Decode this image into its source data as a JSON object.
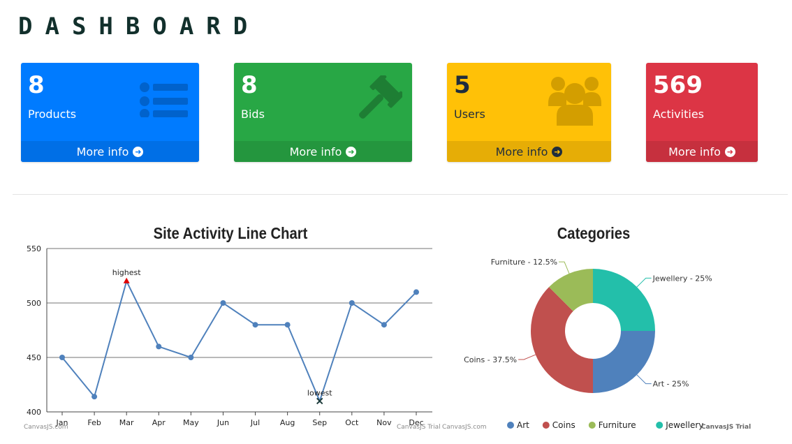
{
  "page": {
    "title": "DASHBOARD"
  },
  "cards": [
    {
      "value": "8",
      "label": "Products",
      "footer": "More info",
      "icon": "list-icon",
      "bg": "#007bff",
      "footer_bg": "#006fe6",
      "text_color": "#ffffff",
      "icon_color": "#0062cc"
    },
    {
      "value": "8",
      "label": "Bids",
      "footer": "More info",
      "icon": "gavel-icon",
      "bg": "#28a745",
      "footer_bg": "#24963e",
      "text_color": "#ffffff",
      "icon_color": "#1e7e34"
    },
    {
      "value": "5",
      "label": "Users",
      "footer": "More info",
      "icon": "users-icon",
      "bg": "#ffc107",
      "footer_bg": "#e6ad06",
      "text_color": "#1f2d3d",
      "icon_color": "#d39e00"
    },
    {
      "value": "569",
      "label": "Activities",
      "footer": "More info",
      "icon": "bar-chart-icon",
      "bg": "#dc3545",
      "footer_bg": "#c6303e",
      "text_color": "#ffffff",
      "icon_color": "#bd2130"
    }
  ],
  "line_chart": {
    "credit_left": "CanvasJS.com",
    "credit_right": "CanvasJS Trial"
  },
  "pie_chart": {
    "credit_left": "CanvasJS.com",
    "credit_right": "CanvasJS Trial"
  },
  "chart_data": [
    {
      "type": "line",
      "title": "Site Activity Line Chart",
      "categories": [
        "Jan",
        "Feb",
        "Mar",
        "Apr",
        "May",
        "Jun",
        "Jul",
        "Aug",
        "Sep",
        "Oct",
        "Nov",
        "Dec"
      ],
      "values": [
        450,
        414,
        520,
        460,
        450,
        500,
        480,
        480,
        410,
        500,
        480,
        510
      ],
      "ylim": [
        400,
        550
      ],
      "yticks": [
        400,
        450,
        500,
        550
      ],
      "grid": true,
      "annotations": [
        {
          "index": 2,
          "text": "highest",
          "marker": "triangle",
          "color": "#e00000"
        },
        {
          "index": 8,
          "text": "lowest",
          "marker": "cross",
          "color": "#1d3b3a"
        }
      ],
      "color": "#4f81bc"
    },
    {
      "type": "pie",
      "title": "Categories",
      "slices": [
        {
          "name": "Art",
          "value": 25,
          "label": "Art - 25%",
          "color": "#4f81bc"
        },
        {
          "name": "Coins",
          "value": 37.5,
          "label": "Coins - 37.5%",
          "color": "#c0504e"
        },
        {
          "name": "Furniture",
          "value": 12.5,
          "label": "Furniture - 12.5%",
          "color": "#9bbb58"
        },
        {
          "name": "Jewellery",
          "value": 25,
          "label": "Jewellery - 25%",
          "color": "#23bfaa"
        }
      ],
      "legend": "bottom"
    }
  ]
}
